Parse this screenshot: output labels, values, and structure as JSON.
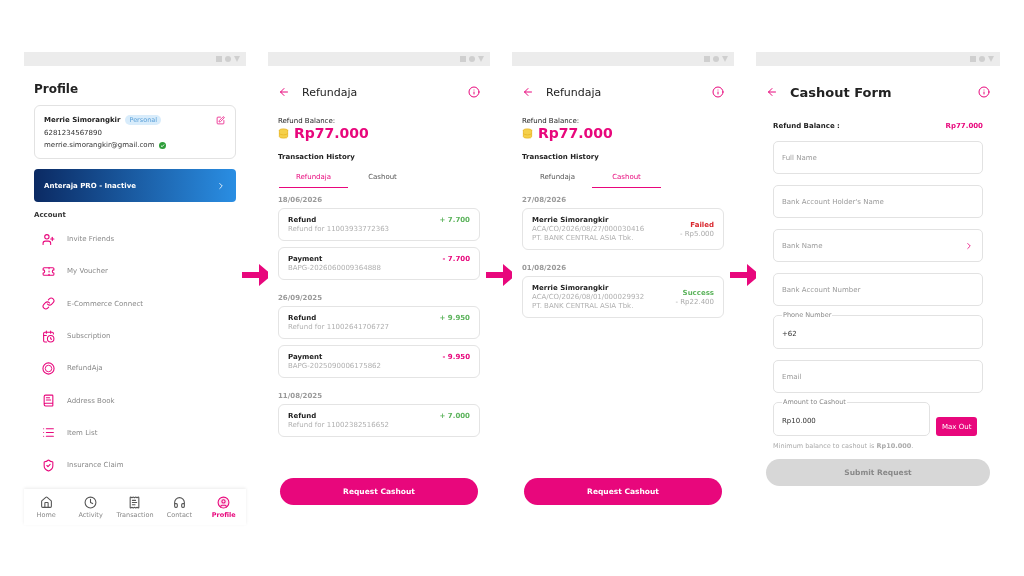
{
  "screens": [
    {
      "kind": "profile",
      "title": "Profile",
      "user": {
        "name": "Merrie Simorangkir",
        "badge": "Personal",
        "phone": "6281234567890",
        "email": "merrie.simorangkir@gmail.com",
        "verified": true
      },
      "banner": "Anteraja PRO - Inactive",
      "section": "Account",
      "menu": [
        "Invite Friends",
        "My Voucher",
        "E-Commerce Connect",
        "Subscription",
        "RefundAja",
        "Address Book",
        "Item List",
        "Insurance Claim"
      ],
      "nav": [
        {
          "label": "Home",
          "selected": false
        },
        {
          "label": "Activity",
          "selected": false
        },
        {
          "label": "Transaction",
          "selected": false
        },
        {
          "label": "Contact",
          "selected": false
        },
        {
          "label": "Profile",
          "selected": true
        }
      ]
    },
    {
      "kind": "history",
      "title": "Refundaja",
      "balance_label": "Refund Balance:",
      "balance": "Rp77.000",
      "section": "Transaction History",
      "tabs": [
        {
          "label": "Refundaja",
          "selected": true
        },
        {
          "label": "Cashout",
          "selected": false
        }
      ],
      "groups": [
        {
          "date": "18/06/2026",
          "entries": [
            {
              "kind": "credit",
              "title": "Refund",
              "lines": [
                "Refund for 11003933772363"
              ],
              "amount": "+ 7.700"
            },
            {
              "kind": "debit",
              "title": "Payment",
              "lines": [
                "BAPG-2026060009364888"
              ],
              "amount": "- 7.700"
            }
          ]
        },
        {
          "date": "26/09/2025",
          "entries": [
            {
              "kind": "credit",
              "title": "Refund",
              "lines": [
                "Refund for 11002641706727"
              ],
              "amount": "+ 9.950"
            },
            {
              "kind": "debit",
              "title": "Payment",
              "lines": [
                "BAPG-2025090006175862"
              ],
              "amount": "- 9.950"
            }
          ]
        },
        {
          "date": "11/08/2025",
          "entries": [
            {
              "kind": "credit",
              "title": "Refund",
              "lines": [
                "Refund for 11002382516652"
              ],
              "amount": "+ 7.000"
            }
          ]
        }
      ],
      "button": "Request Cashout"
    },
    {
      "kind": "history",
      "title": "Refundaja",
      "balance_label": "Refund Balance:",
      "balance": "Rp77.000",
      "section": "Transaction History",
      "tabs": [
        {
          "label": "Refundaja",
          "selected": false
        },
        {
          "label": "Cashout",
          "selected": true
        }
      ],
      "groups": [
        {
          "date": "27/08/2026",
          "entries": [
            {
              "kind": "cashout",
              "color": "#d9272e",
              "status": "Failed",
              "title": "Merrie Simorangkir",
              "lines": [
                "ACA/CO/2026/08/27/000030416",
                "PT. BANK CENTRAL ASIA Tbk."
              ],
              "amount": "- Rp5.000"
            }
          ]
        },
        {
          "date": "01/08/2026",
          "entries": [
            {
              "kind": "cashout",
              "color": "#5bb35b",
              "status": "Success",
              "title": "Merrie Simorangkir",
              "lines": [
                "ACA/CO/2026/08/01/000029932",
                "PT. BANK CENTRAL ASIA Tbk."
              ],
              "amount": "- Rp22.400"
            }
          ]
        }
      ],
      "button": "Request Cashout"
    },
    {
      "kind": "form",
      "title": "Cashout Form",
      "balance_label": "Refund Balance :",
      "balance": "Rp77.000",
      "fields": [
        {
          "kind": "text",
          "placeholder": "Full Name"
        },
        {
          "kind": "text",
          "placeholder": "Bank Account Holder's Name"
        },
        {
          "kind": "select",
          "placeholder": "Bank Name"
        },
        {
          "kind": "text",
          "placeholder": "Bank Account Number"
        },
        {
          "kind": "outlined",
          "label": "Phone Number",
          "value": "+62"
        },
        {
          "kind": "text",
          "placeholder": "Email"
        }
      ],
      "amount": {
        "label": "Amount to Cashout",
        "value": "Rp10.000"
      },
      "max_button": "Max Out",
      "hint": "Minimum balance to cashout is **Rp10.000**.",
      "submit": {
        "label": "Submit Request",
        "disabled": true
      }
    }
  ]
}
